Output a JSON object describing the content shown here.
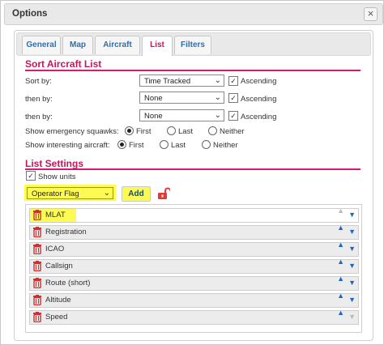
{
  "dialog": {
    "title": "Options",
    "close_icon": "close-icon"
  },
  "tabs": [
    {
      "label": "General",
      "active": false
    },
    {
      "label": "Map",
      "active": false
    },
    {
      "label": "Aircraft",
      "active": false
    },
    {
      "label": "List",
      "active": true
    },
    {
      "label": "Filters",
      "active": false
    }
  ],
  "sort": {
    "title": "Sort Aircraft List",
    "rows": [
      {
        "label": "Sort by:",
        "value": "Time Tracked",
        "ascending_label": "Ascending",
        "ascending": true
      },
      {
        "label": "then by:",
        "value": "None",
        "ascending_label": "Ascending",
        "ascending": true
      },
      {
        "label": "then by:",
        "value": "None",
        "ascending_label": "Ascending",
        "ascending": true
      }
    ],
    "emergency": {
      "label": "Show emergency squawks:",
      "options": [
        "First",
        "Last",
        "Neither"
      ],
      "selected": "First"
    },
    "interesting": {
      "label": "Show interesting aircraft:",
      "options": [
        "First",
        "Last",
        "Neither"
      ],
      "selected": "First"
    }
  },
  "list_settings": {
    "title": "List Settings",
    "show_units_label": "Show units",
    "show_units": true,
    "column_select": "Operator Flag",
    "add_label": "Add",
    "highlight_color": "#fdfb53",
    "columns": [
      "MLAT",
      "Registration",
      "ICAO",
      "Callsign",
      "Route (short)",
      "Altitude",
      "Speed"
    ]
  },
  "colors": {
    "accent": "#c2185b",
    "tab_text": "#2b6fb2",
    "arrow": "#1f66c2",
    "trash": "#d32f2f",
    "lock": "#e53935"
  }
}
